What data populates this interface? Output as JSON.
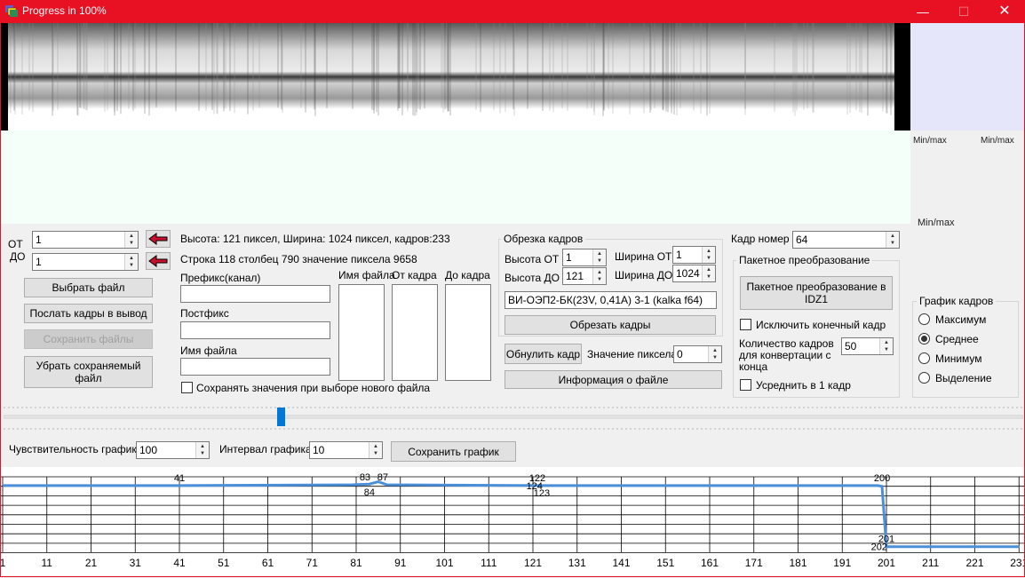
{
  "window": {
    "title": "Progress in 100%",
    "minimize": "—",
    "maximize": "☐",
    "close": "✕"
  },
  "minmax": {
    "label_left": "Min/max",
    "label_right": "Min/max",
    "label_lower": "Min/max"
  },
  "range": {
    "from_label": "ОТ",
    "to_label": "ДО",
    "from_value": "1",
    "to_value": "1"
  },
  "buttons": {
    "choose_file": "Выбрать файл",
    "send_frames": "Послать кадры в вывод",
    "save_files": "Сохранить файлы",
    "remove_saved": "Убрать сохраняемый файл",
    "crop_frames": "Обрезать кадры",
    "reset_frame": "Обнулить кадр",
    "file_info": "Информация о файле",
    "batch_convert": "Пакетное преобразование в IDZ1",
    "save_chart": "Сохранить график"
  },
  "info": {
    "dimensions": "Высота: 121 пиксел, Ширина: 1024 пиксел, кадров:233",
    "pixel": "Строка 118 столбец 790 значение пиксела 9658"
  },
  "naming": {
    "prefix_label": "Префикс(канал)",
    "prefix_value": "",
    "postfix_label": "Постфикс",
    "postfix_value": "",
    "filename_label": "Имя файла",
    "filename_value": "",
    "keep_values_label": "Сохранять значения при выборе нового файла"
  },
  "columns": {
    "filename": "Имя файла",
    "from_frame": "От кадра",
    "to_frame": "До кадра"
  },
  "crop": {
    "legend": "Обрезка кадров",
    "height_from_label": "Высота ОТ",
    "height_from": "1",
    "height_to_label": "Высота ДО",
    "height_to": "121",
    "width_from_label": "Ширина ОТ",
    "width_from": "1",
    "width_to_label": "Ширина ДО",
    "width_to": "1024",
    "device": "ВИ-ОЭП2-БК(23V, 0,41A)  3-1 (kalka f64)"
  },
  "pixel_value": {
    "label": "Значение пиксела",
    "value": "0"
  },
  "frame_number": {
    "label": "Кадр номер",
    "value": "64"
  },
  "batch": {
    "legend": "Пакетное преобразование",
    "exclude_last": "Исключить конечный кадр",
    "count_label": "Количество кадров для конвертации с конца",
    "count_value": "50",
    "average_one": "Усреднить в 1 кадр"
  },
  "frame_chart": {
    "legend": "График кадров",
    "options": [
      "Максимум",
      "Среднее",
      "Минимум",
      "Выделение"
    ],
    "selected": "Среднее"
  },
  "chart_controls": {
    "sensitivity_label": "Чувствительность графика",
    "sensitivity_value": "100",
    "interval_label": "Интервал графика",
    "interval_value": "10"
  },
  "slider": {
    "position": 0.272
  },
  "chart_data": {
    "type": "line",
    "x_ticks": [
      "1",
      "11",
      "21",
      "31",
      "41",
      "51",
      "61",
      "71",
      "81",
      "91",
      "101",
      "111",
      "121",
      "131",
      "141",
      "151",
      "161",
      "171",
      "181",
      "191",
      "201",
      "211",
      "221",
      "231"
    ],
    "xlim": [
      1,
      231
    ],
    "ylim": [
      0,
      100
    ],
    "point_labels": [
      {
        "x": 41,
        "y": 85,
        "text": "41",
        "pos": "above"
      },
      {
        "x": 83,
        "y": 86,
        "text": "83",
        "pos": "above"
      },
      {
        "x": 87,
        "y": 86,
        "text": "87",
        "pos": "above"
      },
      {
        "x": 84,
        "y": 86,
        "text": "84",
        "pos": "below"
      },
      {
        "x": 122,
        "y": 85,
        "text": "122",
        "pos": "above"
      },
      {
        "x": 124,
        "y": 85,
        "text": "124",
        "pos": "left"
      },
      {
        "x": 123,
        "y": 85,
        "text": "123",
        "pos": "below"
      },
      {
        "x": 200,
        "y": 85,
        "text": "200",
        "pos": "above"
      },
      {
        "x": 201,
        "y": 5,
        "text": "201",
        "pos": "above"
      },
      {
        "x": 202,
        "y": 5,
        "text": "202",
        "pos": "left"
      }
    ],
    "series": [
      {
        "color": "#4a8fd9",
        "x": [
          1,
          41,
          80,
          84,
          86,
          88,
          122,
          124,
          199,
          200,
          201,
          202,
          231
        ],
        "y": [
          85,
          85,
          86,
          87,
          90,
          86,
          85,
          85,
          85,
          84,
          5,
          5,
          5
        ]
      }
    ]
  }
}
